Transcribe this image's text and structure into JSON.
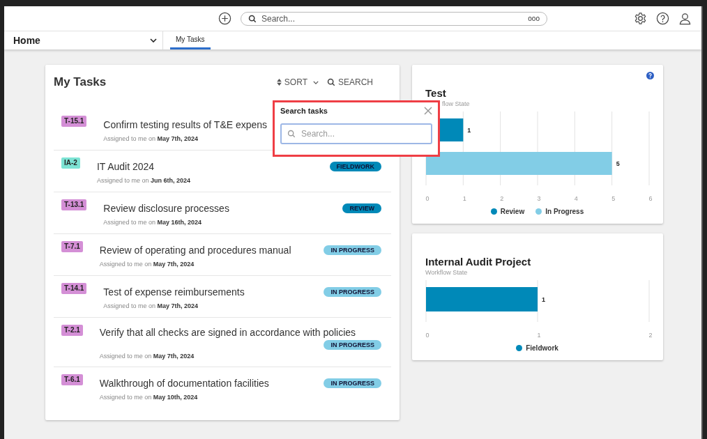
{
  "top_bar": {
    "search": {
      "placeholder": "Search...",
      "more": "ooo"
    }
  },
  "nav": {
    "home": "Home",
    "tabs": [
      {
        "label": "My Tasks",
        "selected": true
      }
    ]
  },
  "tasks_card": {
    "title": "My Tasks",
    "sort": "SORT",
    "search": "SEARCH",
    "tasks": [
      {
        "tag": {
          "text": "T-15.1",
          "color": "#d48fd6"
        },
        "title": "Confirm testing results of T&E expens",
        "assigned": "Assigned to me on **May 7th, 2024**"
      },
      {
        "tag": {
          "text": "IA-2",
          "color": "#7de3d4"
        },
        "title": "IT Audit 2024",
        "assigned": "Assigned to me on **Jun 6th, 2024**",
        "status": {
          "text": "FIELDWORK",
          "color": "#0089b8"
        }
      },
      {
        "tag": {
          "text": "T-13.1",
          "color": "#d48fd6"
        },
        "title": "Review disclosure processes",
        "assigned": "Assigned to me on **May 16th, 2024**",
        "status": {
          "text": "REVIEW",
          "color": "#0089b8"
        }
      },
      {
        "tag": {
          "text": "T-7.1",
          "color": "#d48fd6"
        },
        "title": "Review of operating and procedures manual",
        "assigned": "Assigned to me on **May 7th, 2024**",
        "status": {
          "text": "IN PROGRESS",
          "color": "#82cde6"
        }
      },
      {
        "tag": {
          "text": "T-14.1",
          "color": "#d48fd6"
        },
        "title": "Test of expense reimbursements",
        "assigned": "Assigned to me on **May 7th, 2024**",
        "status": {
          "text": "IN PROGRESS",
          "color": "#82cde6"
        }
      },
      {
        "tag": {
          "text": "T-2.1",
          "color": "#d48fd6"
        },
        "title": "Verify that all checks are signed in accordance with policies",
        "assigned": "Assigned to me on **May 7th, 2024**",
        "status": {
          "text": "IN PROGRESS",
          "color": "#82cde6"
        }
      },
      {
        "tag": {
          "text": "T-6.1",
          "color": "#d48fd6"
        },
        "title": "Walkthrough of documentation facilities",
        "assigned": "Assigned to me on **May 10th, 2024**",
        "status": {
          "text": "IN PROGRESS",
          "color": "#82cde6"
        }
      }
    ]
  },
  "search_popup": {
    "title": "Search tasks",
    "placeholder": "Search..."
  },
  "charts": [
    {
      "title": "Test",
      "subtitle": "flow State",
      "help": true,
      "chart_data": {
        "type": "bar",
        "orientation": "horizontal",
        "series": [
          {
            "name": "Review",
            "color": "#0089b8",
            "values": [
              1,
              null
            ]
          },
          {
            "name": "In Progress",
            "color": "#82cde6",
            "values": [
              null,
              5
            ]
          }
        ],
        "xlim": [
          0,
          6
        ],
        "xticks": [
          0,
          1,
          2,
          3,
          4,
          5,
          6
        ],
        "grid": true,
        "data_labels": true
      }
    },
    {
      "title": "Internal Audit Project",
      "subtitle": "Workflow State",
      "help": false,
      "chart_data": {
        "type": "bar",
        "orientation": "horizontal",
        "series": [
          {
            "name": "Fieldwork",
            "color": "#0089b8",
            "values": [
              1
            ]
          }
        ],
        "xlim": [
          0,
          2
        ],
        "xticks": [
          0,
          1,
          2
        ],
        "grid": true,
        "data_labels": true
      }
    }
  ]
}
